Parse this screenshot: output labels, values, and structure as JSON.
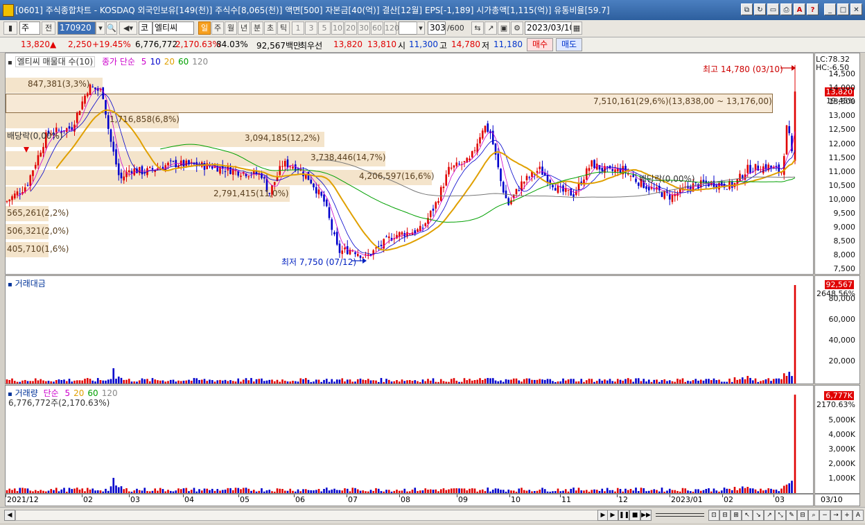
{
  "title": {
    "text": "[0601] 주식종합차트 - KOSDAQ 외국인보유[149(천)] 주식수[8,065(천)] 액면[500] 자본금[40(억)] 결산[12월] EPS[-1,189] 시가총액[1,115(억)] 유통비율[59.7]"
  },
  "toolbar": {
    "market_select": "주",
    "prev_label": "전",
    "code": "170920",
    "name_prefix": "코",
    "name": "엘티씨",
    "periods": [
      "일",
      "주",
      "월",
      "년",
      "분",
      "초",
      "틱"
    ],
    "active_period": "일",
    "intervals": [
      "1",
      "3",
      "5",
      "10",
      "20",
      "30",
      "60",
      "120"
    ],
    "count": "303",
    "count_max": "/600",
    "date": "2023/03/10"
  },
  "quote": {
    "price": "13,820",
    "arrow": "▲",
    "change": "2,250",
    "change_pct": "+19.45%",
    "volume": "6,776,772",
    "vol_ratio": "2,170.63%",
    "rate": "84.03%",
    "amount": "92,567백만",
    "best_label": "최우선",
    "ask": "13,820",
    "bid": "13,810",
    "open_label": "시",
    "open": "11,300",
    "high_label": "고",
    "high": "14,780",
    "low_label": "저",
    "low": "11,180",
    "buy": "매수",
    "sell": "매도"
  },
  "price_pane": {
    "legend_name": "엘티씨 매물대 수(10)",
    "ma_label": "종가 단순",
    "ma_periods": [
      "5",
      "10",
      "20",
      "60",
      "120"
    ],
    "ma_colors": [
      "#cc00cc",
      "#0000cc",
      "#e0a000",
      "#00a000",
      "#888888"
    ],
    "band_labels": [
      "847,381(3,3%)",
      "1,716,858(6,8%)",
      "3,094,185(12,2%)",
      "3,738,446(14,7%)",
      "7,510,161(29,6%)(13,838,00 ~ 13,176,00)",
      "4,206,597(16,6%)",
      "2,791,415(11,0%)",
      "565,261(2,2%)",
      "506,321(2,0%)",
      "405,710(1,6%)"
    ],
    "high_note": "최고 14,780 (03/10)",
    "low_note": "최저 7,750 (07/12)",
    "dividend_left": "배당락(0,00%)",
    "dividend_right": "배당락(0,00%)",
    "axis_ticks": [
      "14,500",
      "14,000",
      "13,500",
      "13,000",
      "12,500",
      "12,000",
      "11,500",
      "11,000",
      "10,500",
      "10,000",
      "9,500",
      "9,000",
      "8,500",
      "8,000",
      "7,500"
    ],
    "lc": "LC:78.32",
    "hc": "HC:-6.50",
    "price_tag": "13,820",
    "price_tag_pct": "19.45%"
  },
  "amount_pane": {
    "label": "거래대금",
    "axis_ticks": [
      "80,000",
      "60,000",
      "40,000",
      "20,000"
    ],
    "tag": "92,567",
    "tag_pct": "2648.56%"
  },
  "volume_pane": {
    "label": "거래량",
    "ma_label": "단순",
    "ma_periods": [
      "5",
      "20",
      "60",
      "120"
    ],
    "sub": "6,776,772주(2,170.63%)",
    "axis_ticks": [
      "5,000K",
      "4,000K",
      "3,000K",
      "2,000K",
      "1,000K"
    ],
    "tag": "6,777K",
    "tag_pct": "2170.63%"
  },
  "x_axis": {
    "labels": [
      "2021/12",
      "02",
      "03",
      "04",
      "05",
      "06",
      "07",
      "08",
      "09",
      "10",
      "11",
      "12",
      "2023/01",
      "02",
      "03"
    ],
    "right_label": "03/10"
  },
  "colors": {
    "up": "#e00000",
    "down": "#0000cc",
    "band": "#ebcda0"
  },
  "chart_data": {
    "type": "candlestick",
    "title": "엘티씨",
    "price_range": [
      7500,
      14800
    ],
    "series": [
      {
        "name": "종가 단순 5"
      },
      {
        "name": "종가 단순 10"
      },
      {
        "name": "종가 단순 20"
      },
      {
        "name": "종가 단순 60"
      },
      {
        "name": "종가 단순 120"
      }
    ],
    "last": {
      "date": "2023/03/10",
      "open": 11300,
      "high": 14780,
      "low": 11180,
      "close": 13820,
      "volume": 6776772,
      "amount_million": 92567
    },
    "period_high": {
      "date": "03/10",
      "value": 14780
    },
    "period_low": {
      "date": "07/12",
      "value": 7750
    },
    "monthly_close_approx": [
      {
        "x": "2021/12",
        "y": 10000
      },
      {
        "x": "02",
        "y": 13800
      },
      {
        "x": "03",
        "y": 11000
      },
      {
        "x": "04",
        "y": 11100
      },
      {
        "x": "05",
        "y": 10900
      },
      {
        "x": "06",
        "y": 10600
      },
      {
        "x": "07",
        "y": 7900
      },
      {
        "x": "08",
        "y": 8800
      },
      {
        "x": "09",
        "y": 12600
      },
      {
        "x": "10",
        "y": 10300
      },
      {
        "x": "11",
        "y": 11000
      },
      {
        "x": "12",
        "y": 10200
      },
      {
        "x": "2023/01",
        "y": 10500
      },
      {
        "x": "02",
        "y": 11200
      },
      {
        "x": "03",
        "y": 13820
      }
    ]
  }
}
